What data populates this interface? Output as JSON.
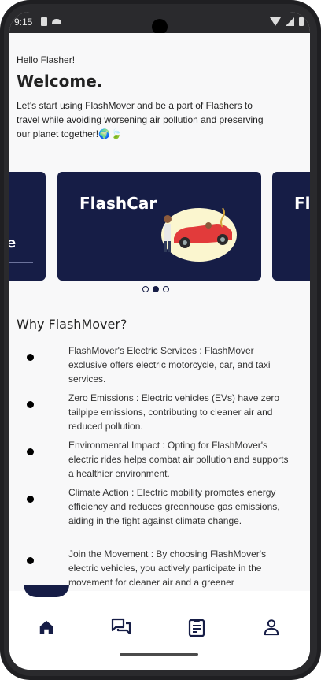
{
  "status_bar": {
    "time": "9:15"
  },
  "header": {
    "greeting": "Hello Flasher!",
    "title": "Welcome.",
    "intro": "Let’s start using FlashMover and be a part of Flashers to travel while avoiding worsening air pollution and preserving our planet together!🌍🍃"
  },
  "carousel": {
    "cards": [
      {
        "title": "e"
      },
      {
        "title": "FlashCar"
      },
      {
        "title": "Fl"
      }
    ],
    "active_index": 1,
    "page_count": 3
  },
  "why": {
    "title": "Why FlashMover?",
    "items": [
      {
        "text": "FlashMover's Electric Services : FlashMover exclusive offers electric motorcycle, car, and taxi services."
      },
      {
        "text": "Zero Emissions : Electric vehicles (EVs) have zero tailpipe emissions, contributing to cleaner air and reduced pollution."
      },
      {
        "text": "Environmental Impact : Opting for FlashMover's electric rides helps combat air pollution and supports a healthier environment."
      },
      {
        "text": "Climate Action : Electric mobility promotes energy efficiency and reduces greenhouse gas emissions, aiding in the fight against climate change."
      },
      {
        "text": "Join the Movement : By choosing FlashMover's electric vehicles, you actively participate in the movement for cleaner air and a greener"
      }
    ]
  },
  "nav": {
    "items": [
      {
        "icon": "home-icon",
        "active": true
      },
      {
        "icon": "chat-icon",
        "active": false
      },
      {
        "icon": "clipboard-icon",
        "active": false
      },
      {
        "icon": "profile-icon",
        "active": false
      }
    ],
    "color_active": "#161d46"
  },
  "colors": {
    "brand_navy": "#161d46",
    "background": "#f8f8f9"
  }
}
